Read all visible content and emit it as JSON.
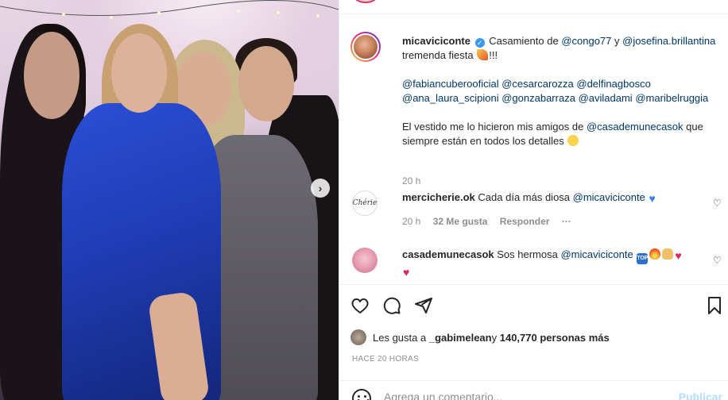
{
  "post": {
    "author": "micaviciconte",
    "verified_icon": "verified-badge-icon",
    "caption_parts": {
      "p1_text": "Casamiento de ",
      "m1": "@congo77",
      "p1_and": " y ",
      "m2": "@josefina.brillantina",
      "p1_end": "tremenda fiesta",
      "p1_excl": "!!!",
      "tags": [
        "@fabiancuberooficial",
        "@cesarcarozza",
        "@delfinagbosco",
        "@ana_laura_scipioni",
        "@gonzabarraza",
        "@aviladami",
        "@maribelruggia"
      ],
      "p3_text": "El vestido me lo hicieron mis amigos de ",
      "m3": "@casademunecasok",
      "p3_end": " que siempre están en todos los detalles"
    },
    "time": "20 h"
  },
  "comments": [
    {
      "user": "mercicherie.ok",
      "avatar_text": "Chérie",
      "text": "Cada día más diosa ",
      "mention": "@micaviciconte",
      "time": "20 h",
      "likes": "32 Me gusta",
      "reply": "Responder",
      "more": "···"
    },
    {
      "user": "casademunecasok",
      "text": "Sos hermosa ",
      "mention": "@micaviciconte"
    }
  ],
  "likes": {
    "prefix": "Les gusta a ",
    "user": "_gabimelean",
    "middle": " y ",
    "count": "140,770 personas más"
  },
  "time_upper": "HACE 20 HORAS",
  "comment_input": {
    "placeholder": "Agrega un comentario...",
    "publish": "Publicar"
  },
  "colors": {
    "mention": "#00376b",
    "publish_disabled": "#b2dffc",
    "verified": "#3897f0"
  }
}
